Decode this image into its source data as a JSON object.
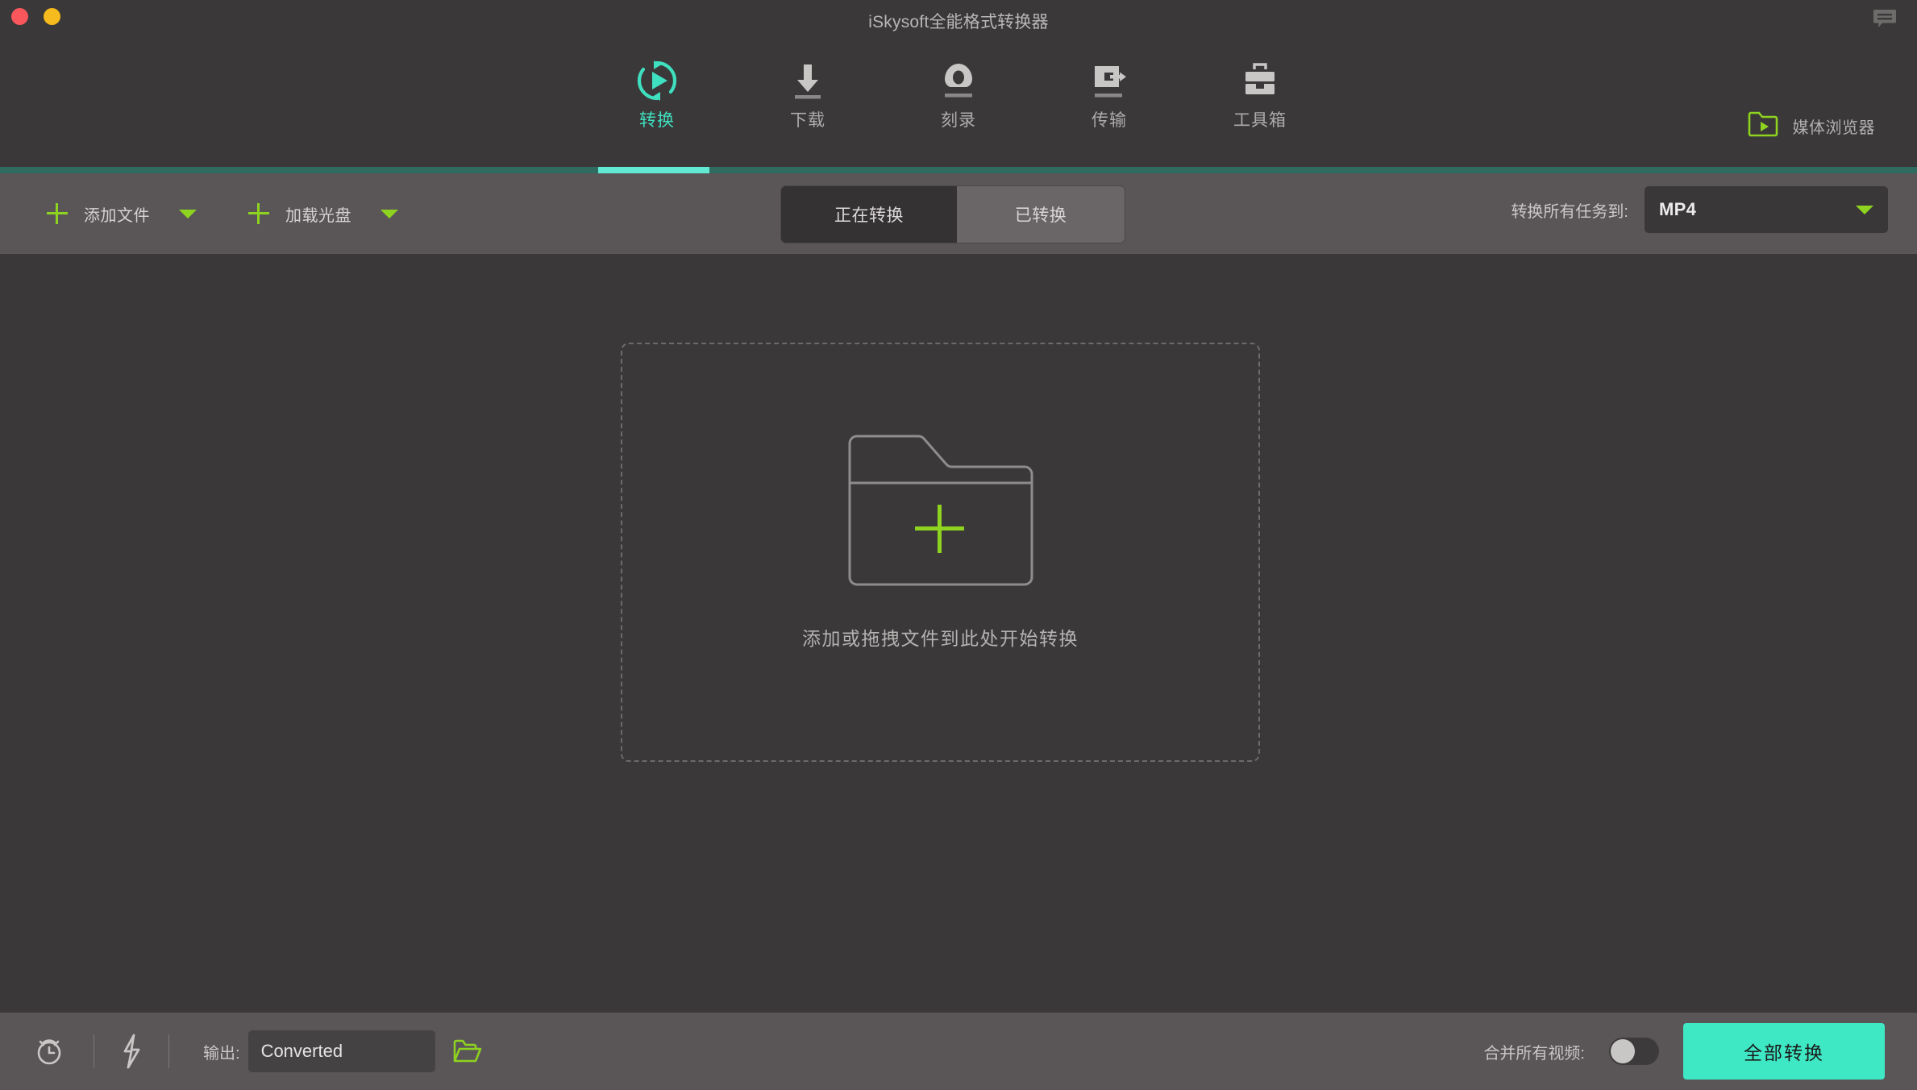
{
  "window": {
    "title": "iSkysoft全能格式转换器",
    "traffic_lights": [
      {
        "name": "close",
        "color": "#f9575c"
      },
      {
        "name": "minimize",
        "color": "#f6bb1c"
      }
    ],
    "feedback_icon": "speech-bubble-icon"
  },
  "nav": {
    "items": [
      {
        "label": "转换",
        "icon": "convert-refresh-play-icon",
        "active": true
      },
      {
        "label": "下载",
        "icon": "download-arrow-icon",
        "active": false
      },
      {
        "label": "刻录",
        "icon": "disc-burn-icon",
        "active": false
      },
      {
        "label": "传输",
        "icon": "transfer-device-icon",
        "active": false
      },
      {
        "label": "工具箱",
        "icon": "toolbox-icon",
        "active": false
      }
    ],
    "media_browser": {
      "label": "媒体浏览器",
      "icon": "folder-play-icon"
    },
    "accent_color": "#3fe0bf",
    "separator_color": "#2f6b5f"
  },
  "toolbar": {
    "add_file": {
      "label": "添加文件",
      "icon": "plus-icon",
      "caret": "chevron-down-icon"
    },
    "load_disc": {
      "label": "加载光盘",
      "icon": "plus-icon",
      "caret": "chevron-down-icon"
    },
    "tabs": [
      {
        "label": "正在转换",
        "active": true
      },
      {
        "label": "已转换",
        "active": false
      }
    ],
    "convert_all_to": {
      "label": "转换所有任务到:",
      "value": "MP4",
      "caret": "chevron-down-icon"
    },
    "green_accent": "#8ed31f"
  },
  "dropzone": {
    "icon": "folder-add-icon",
    "plus_color": "#8ed31f",
    "text": "添加或拖拽文件到此处开始转换"
  },
  "bottombar": {
    "alarm_icon": "alarm-clock-icon",
    "power_icon": "lightning-bolt-icon",
    "output_label": "输出:",
    "output_value": "Converted",
    "output_caret": "chevron-down-icon",
    "open_folder_icon": "folder-open-icon",
    "merge_label": "合并所有视频:",
    "merge_toggle_state": "off",
    "convert_button": "全部转换",
    "convert_button_color": "#3fe8c4"
  }
}
